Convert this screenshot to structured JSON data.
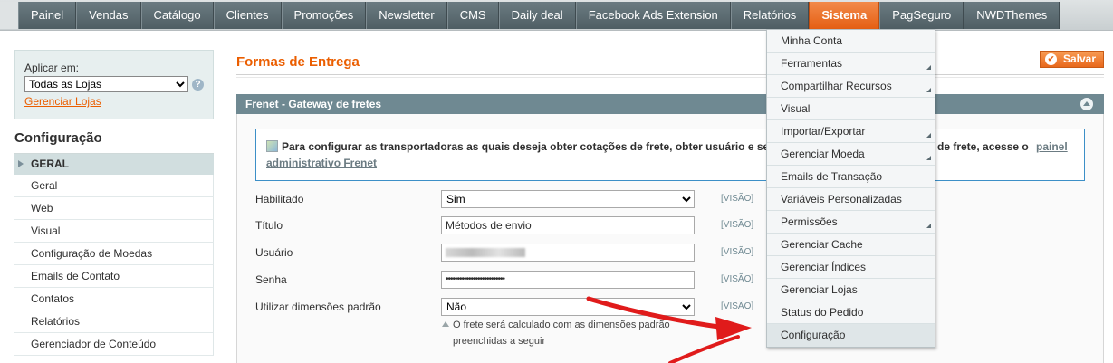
{
  "topnav": {
    "items": [
      {
        "label": "Painel"
      },
      {
        "label": "Vendas"
      },
      {
        "label": "Catálogo"
      },
      {
        "label": "Clientes"
      },
      {
        "label": "Promoções"
      },
      {
        "label": "Newsletter"
      },
      {
        "label": "CMS"
      },
      {
        "label": "Daily deal"
      },
      {
        "label": "Facebook Ads Extension"
      },
      {
        "label": "Relatórios"
      },
      {
        "label": "Sistema",
        "active": true
      },
      {
        "label": "PagSeguro"
      },
      {
        "label": "NWDThemes"
      }
    ],
    "active_color": "#e55f13"
  },
  "system_menu": {
    "items": [
      {
        "label": "Minha Conta",
        "has_submenu": false
      },
      {
        "label": "Ferramentas",
        "has_submenu": true
      },
      {
        "label": "Compartilhar Recursos",
        "has_submenu": true
      },
      {
        "label": "Visual",
        "has_submenu": false
      },
      {
        "label": "Importar/Exportar",
        "has_submenu": true
      },
      {
        "label": "Gerenciar Moeda",
        "has_submenu": true
      },
      {
        "label": "Emails de Transação",
        "has_submenu": false
      },
      {
        "label": "Variáveis Personalizadas",
        "has_submenu": false
      },
      {
        "label": "Permissões",
        "has_submenu": true
      },
      {
        "label": "Gerenciar Cache",
        "has_submenu": false
      },
      {
        "label": "Gerenciar Índices",
        "has_submenu": false
      },
      {
        "label": "Gerenciar Lojas",
        "has_submenu": false
      },
      {
        "label": "Status do Pedido",
        "has_submenu": false
      },
      {
        "label": "Configuração",
        "has_submenu": false
      }
    ]
  },
  "scope": {
    "label": "Aplicar em:",
    "selected": "Todas as Lojas",
    "help_icon": "question-icon",
    "manage_link": "Gerenciar Lojas"
  },
  "sidebar": {
    "title": "Configuração",
    "group": "GERAL",
    "items": [
      {
        "label": "Geral"
      },
      {
        "label": "Web"
      },
      {
        "label": "Visual"
      },
      {
        "label": "Configuração de Moedas"
      },
      {
        "label": "Emails de Contato"
      },
      {
        "label": "Contatos"
      },
      {
        "label": "Relatórios"
      },
      {
        "label": "Gerenciador de Conteúdo"
      }
    ]
  },
  "main": {
    "page_title": "Formas de Entrega",
    "save_label": "Salvar",
    "accent_color": "#eb5e00",
    "section_title": "Frenet - Gateway de fretes",
    "notice": {
      "text_before": "Para configurar as transportadoras as quais deseja obter cotações de frete, obter usuário e se",
      "text_after": "de frete, acesse o",
      "link_part1": "painel",
      "link_part2": "administrativo Frenet"
    },
    "fields": [
      {
        "label": "Habilitado",
        "type": "select",
        "value": "Sim",
        "scope": "[VISÃO]"
      },
      {
        "label": "Título",
        "type": "text",
        "value": "Métodos de envio",
        "scope": "[VISÃO]"
      },
      {
        "label": "Usuário",
        "type": "redacted",
        "value": "",
        "scope": "[VISÃO]"
      },
      {
        "label": "Senha",
        "type": "password",
        "value": "••••••••••••••••••••••••••",
        "scope": "[VISÃO]"
      },
      {
        "label": "Utilizar dimensões padrão",
        "type": "select",
        "value": "Não",
        "scope": "[VISÃO]"
      }
    ],
    "hint_line1": "O frete será calculado com as dimensões padrão",
    "hint_line2": "preenchidas a seguir"
  }
}
